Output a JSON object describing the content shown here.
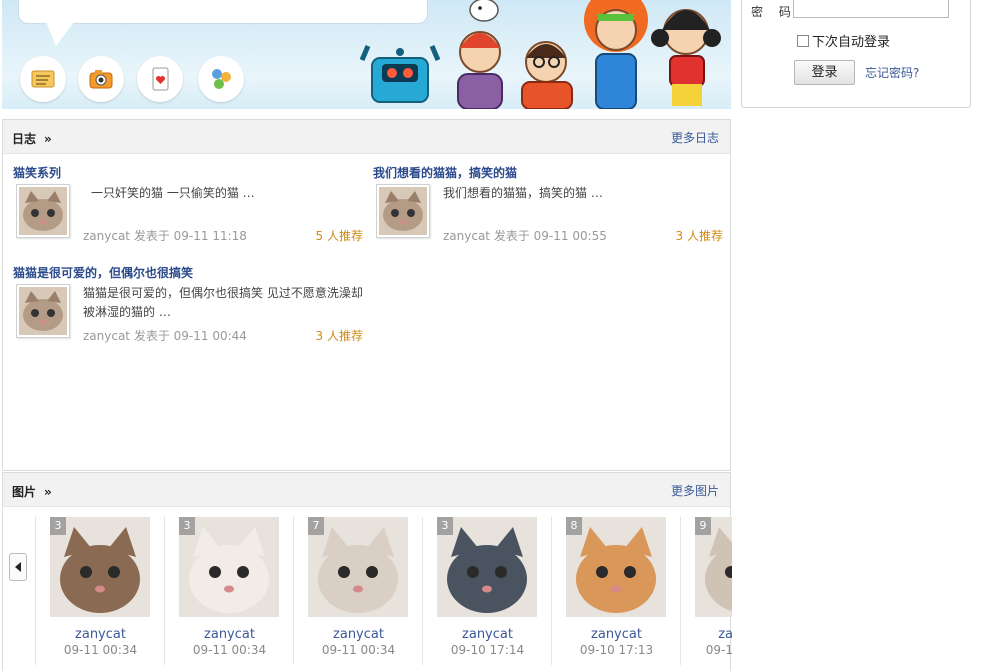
{
  "login": {
    "password_label": "密 码",
    "password_value": "",
    "auto_login_label": "下次自动登录",
    "login_button": "登录",
    "forgot_link": "忘记密码?"
  },
  "blog": {
    "title": "日志",
    "more": "更多日志",
    "posts": [
      {
        "title": "猫笑系列",
        "excerpt": "一只奸笑的猫 一只偷笑的猫 …",
        "meta": "zanycat 发表于 09-11 11:18",
        "recommend": "5 人推荐"
      },
      {
        "title": "我们想看的猫猫，搞笑的猫",
        "excerpt": "我们想看的猫猫，搞笑的猫 …",
        "meta": "zanycat 发表于 09-11 00:55",
        "recommend": "3 人推荐"
      },
      {
        "title": "猫猫是很可爱的，但偶尔也很搞笑",
        "excerpt": "猫猫是很可爱的，但偶尔也很搞笑  见过不愿意洗澡却被淋湿的猫的 …",
        "meta": "zanycat 发表于 09-11 00:44",
        "recommend": "3 人推荐"
      }
    ]
  },
  "photos": {
    "title": "图片",
    "more": "更多图片",
    "items": [
      {
        "count": "3",
        "user": "zanycat",
        "time": "09-11 00:34",
        "color": "#8a6a52"
      },
      {
        "count": "3",
        "user": "zanycat",
        "time": "09-11 00:34",
        "color": "#f2ece6"
      },
      {
        "count": "7",
        "user": "zanycat",
        "time": "09-11 00:34",
        "color": "#d9cfc4"
      },
      {
        "count": "3",
        "user": "zanycat",
        "time": "09-10 17:14",
        "color": "#4a5360"
      },
      {
        "count": "8",
        "user": "zanycat",
        "time": "09-10 17:13",
        "color": "#d9975a"
      },
      {
        "count": "9",
        "user": "za",
        "time": "09-1",
        "color": "#cfc3b6"
      }
    ]
  },
  "icons": [
    "message-icon",
    "camera-icon",
    "card-icon",
    "friends-icon"
  ]
}
